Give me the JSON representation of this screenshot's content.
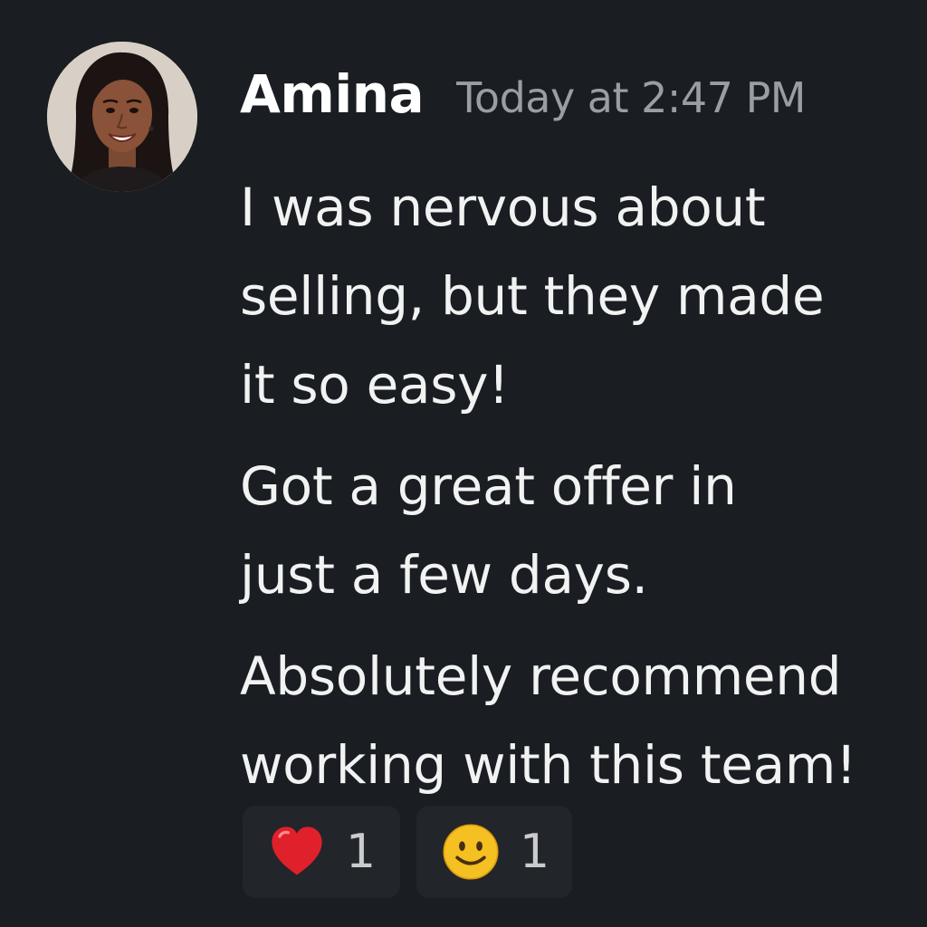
{
  "message": {
    "author": "Amina",
    "timestamp": "Today at 2:47 PM",
    "paragraphs": [
      {
        "lines": [
          "I was nervous about",
          "selling, but they made",
          "it so easy!"
        ]
      },
      {
        "lines": [
          "Got a great offer in",
          "just a few days."
        ]
      },
      {
        "lines": [
          "Absolutely recommend",
          "working with this team!"
        ]
      }
    ]
  },
  "reactions": [
    {
      "icon": "red-heart-icon",
      "count": "1",
      "color": "#e0202b"
    },
    {
      "icon": "smiling-face-icon",
      "count": "1",
      "color": "#f5c022"
    }
  ],
  "colors": {
    "background": "#1a1d21",
    "author": "#ffffff",
    "timestamp": "#9a9da1",
    "body_text": "#f1f2f2",
    "reaction_background": "#222529"
  }
}
